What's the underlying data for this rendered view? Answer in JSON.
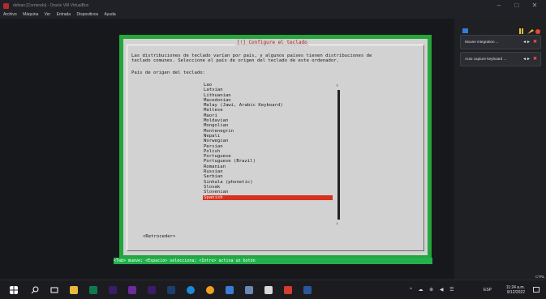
{
  "window": {
    "title": "debian [Corriendo] - Oracle VM VirtualBox",
    "minimize": "–",
    "maximize": "□",
    "close": "✕"
  },
  "menu": [
    "Archivo",
    "Máquina",
    "Ver",
    "Entrada",
    "Dispositivos",
    "Ayuda"
  ],
  "dialog": {
    "title": "[!] Configure el teclado",
    "description_line1": "Las distribuciones de teclado varían por país, y algunos países tienen distribuciones de",
    "description_line2": "teclado comunes. Seleccione el país de origen del teclado de este ordenador.",
    "prompt": "País de origen del teclado:",
    "scroll_up": "↑",
    "scroll_down": "↓",
    "back_button": "<Retroceder>",
    "items": [
      "Lao",
      "Latvian",
      "Lithuanian",
      "Macedonian",
      "Malay (Jawi, Arabic Keyboard)",
      "Maltese",
      "Maori",
      "Moldavian",
      "Mongolian",
      "Montenegrin",
      "Nepali",
      "Norwegian",
      "Persian",
      "Polish",
      "Portuguese",
      "Portuguese (Brazil)",
      "Romanian",
      "Russian",
      "Serbian",
      "Sinhala (phonetic)",
      "Slovak",
      "Slovenian",
      "Spanish"
    ],
    "selected": "Spanish"
  },
  "status_bar": "<Tab> mueve; <Espacio> selecciona; <Intro> activa un botón",
  "side_panel": {
    "notifications": [
      {
        "label": "Mouse integration ...",
        "pin": "◄►",
        "close": "✖"
      },
      {
        "label": "Auto capture keyboard ...",
        "pin": "◄►",
        "close": "✖"
      }
    ]
  },
  "host_key": "CTRL DERECHA",
  "taskbar": {
    "time": "11:24 a.m.",
    "date": "9/12/2022",
    "language": "ESP",
    "tray_icons": "^ ☁ ⊕ ◀ ☰"
  },
  "colors": {
    "dialog_bg": "#d2d2d2",
    "dialog_border": "#25a63c",
    "selection": "#d8301e",
    "title_red": "#b4231f"
  }
}
